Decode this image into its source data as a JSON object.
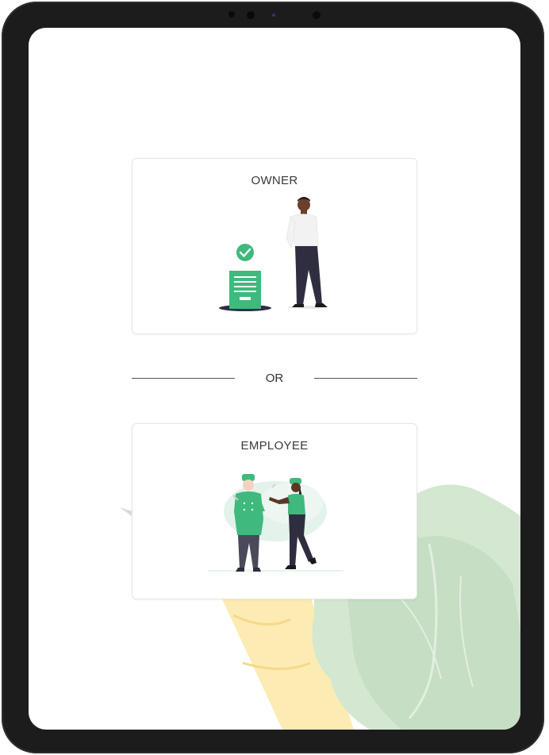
{
  "roles": {
    "owner": {
      "label": "OWNER"
    },
    "employee": {
      "label": "EMPLOYEE"
    }
  },
  "divider": {
    "label": "OR"
  },
  "icons": {
    "owner": "owner-with-document-icon",
    "employee": "chefs-icon",
    "check": "checkmark-icon"
  },
  "colors": {
    "accent": "#3fb97d",
    "background_leaf": "#cfe3cd",
    "background_carrot": "#fbe7a6",
    "device_frame": "#1c1c1d"
  }
}
